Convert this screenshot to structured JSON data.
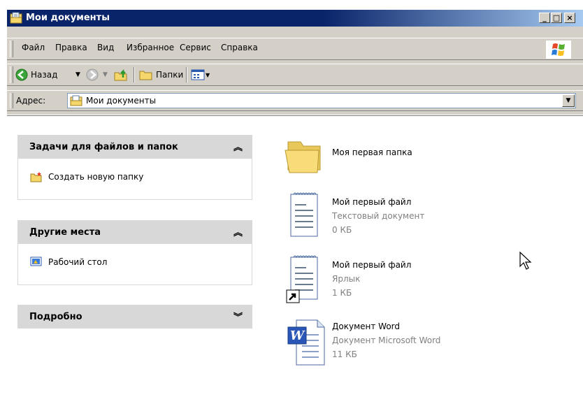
{
  "window": {
    "title": "Мои документы"
  },
  "menu": {
    "items": [
      {
        "label": "Файл"
      },
      {
        "label": "Правка"
      },
      {
        "label": "Вид"
      },
      {
        "label": "Избранное"
      },
      {
        "label": "Сервис"
      },
      {
        "label": "Справка"
      }
    ]
  },
  "toolbar": {
    "back_label": "Назад",
    "folders_label": "Папки"
  },
  "address": {
    "label": "Адрес:",
    "value": "Мои документы"
  },
  "panels": {
    "tasks": {
      "title": "Задачи для файлов и папок",
      "links": [
        {
          "label": "Создать новую папку"
        }
      ],
      "state": "expanded"
    },
    "places": {
      "title": "Другие места",
      "links": [
        {
          "label": "Рабочий стол"
        }
      ],
      "state": "expanded"
    },
    "details": {
      "title": "Подробно",
      "state": "collapsed"
    }
  },
  "files": [
    {
      "name": "Моя первая папка",
      "type": "",
      "size": "",
      "icon": "folder-icon"
    },
    {
      "name": "Мой первый файл",
      "type": "Текстовый документ",
      "size": "0 КБ",
      "icon": "text-document-icon"
    },
    {
      "name": "Мой первый файл",
      "type": "Ярлык",
      "size": "1 КБ",
      "icon": "shortcut-icon"
    },
    {
      "name": "Документ Word",
      "type": "Документ Microsoft Word",
      "size": "11 КБ",
      "icon": "word-document-icon"
    }
  ],
  "colors": {
    "title_bar": "#0a246a",
    "chrome": "#d4d0c8",
    "panel_header": "#d8d8d8",
    "meta_text": "#808080"
  }
}
